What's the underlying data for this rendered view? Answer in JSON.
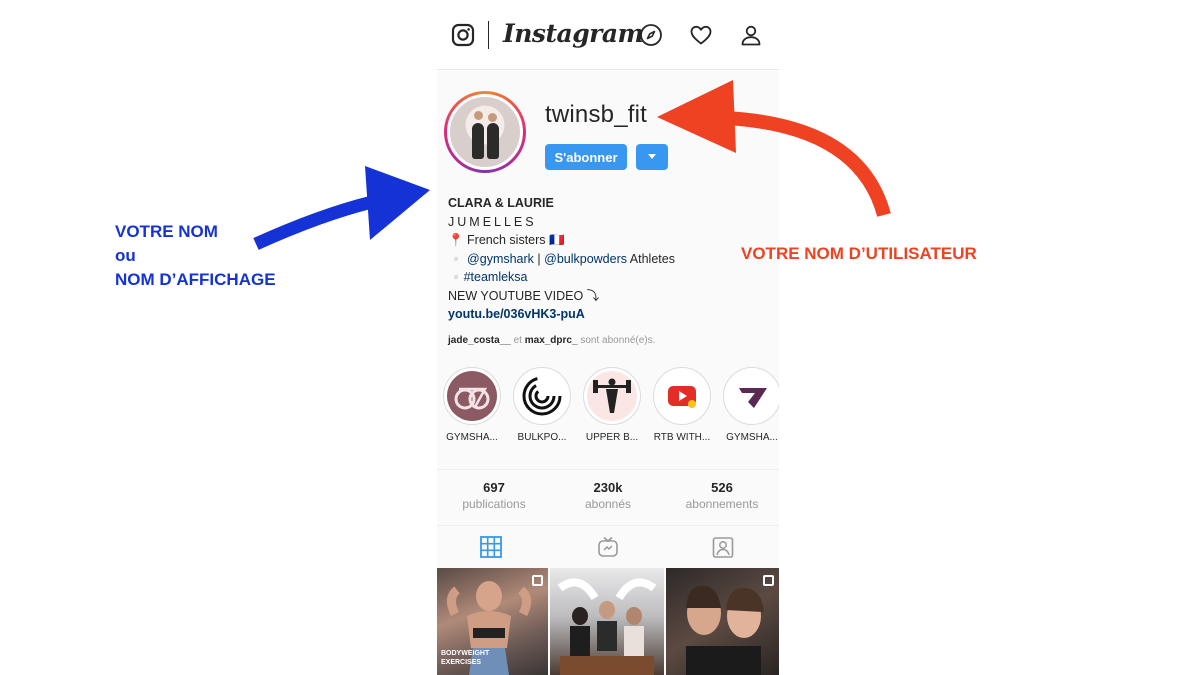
{
  "nav": {
    "wordmark": "Instagram",
    "icons": [
      "instagram-logo-icon",
      "compass-icon",
      "heart-icon",
      "person-icon"
    ]
  },
  "profile": {
    "username": "twinsb_fit",
    "follow_label": "S'abonner",
    "bio": {
      "name": "CLARA & LAURIE",
      "line2": "JUMELLES",
      "line3": "📍 French sisters 🇫🇷",
      "line4_prefix": "▫️ ",
      "mention1": "@gymshark",
      "sep": " | ",
      "mention2": "@bulkpowders",
      "line4_suffix": " Athletes",
      "line5_prefix": "▫️",
      "hashtag": "#teamleksa",
      "line6": "NEW YOUTUBE VIDEO ⤵",
      "url": "youtu.be/036vHK3-puA"
    },
    "followed_by": {
      "user1": "jade_costa__",
      "connector": " et ",
      "user2": "max_dprc_",
      "suffix": " sont abonné(e)s."
    }
  },
  "highlights": [
    {
      "label": "GYMSHA..."
    },
    {
      "label": "BULKPO..."
    },
    {
      "label": "UPPER B..."
    },
    {
      "label": "RTB WITH..."
    },
    {
      "label": "GYMSHA..."
    }
  ],
  "stats": [
    {
      "num": "697",
      "label": "publications"
    },
    {
      "num": "230k",
      "label": "abonnés"
    },
    {
      "num": "526",
      "label": "abonnements"
    }
  ],
  "tabs": [
    "grid-icon",
    "igtv-icon",
    "tagged-icon"
  ],
  "grid": [
    {
      "caption": "BODYWEIGHT EXERCISES"
    },
    {
      "caption": ""
    },
    {
      "caption": ""
    }
  ],
  "annotations": {
    "left_line1": "VOTRE NOM",
    "left_line2": "ou",
    "left_line3": "NOM D’AFFICHAGE",
    "right": "VOTRE NOM D’UTILISATEUR"
  },
  "colors": {
    "follow_blue": "#3897f0",
    "annotation_blue": "#1432d6",
    "annotation_red": "#ee4222"
  }
}
